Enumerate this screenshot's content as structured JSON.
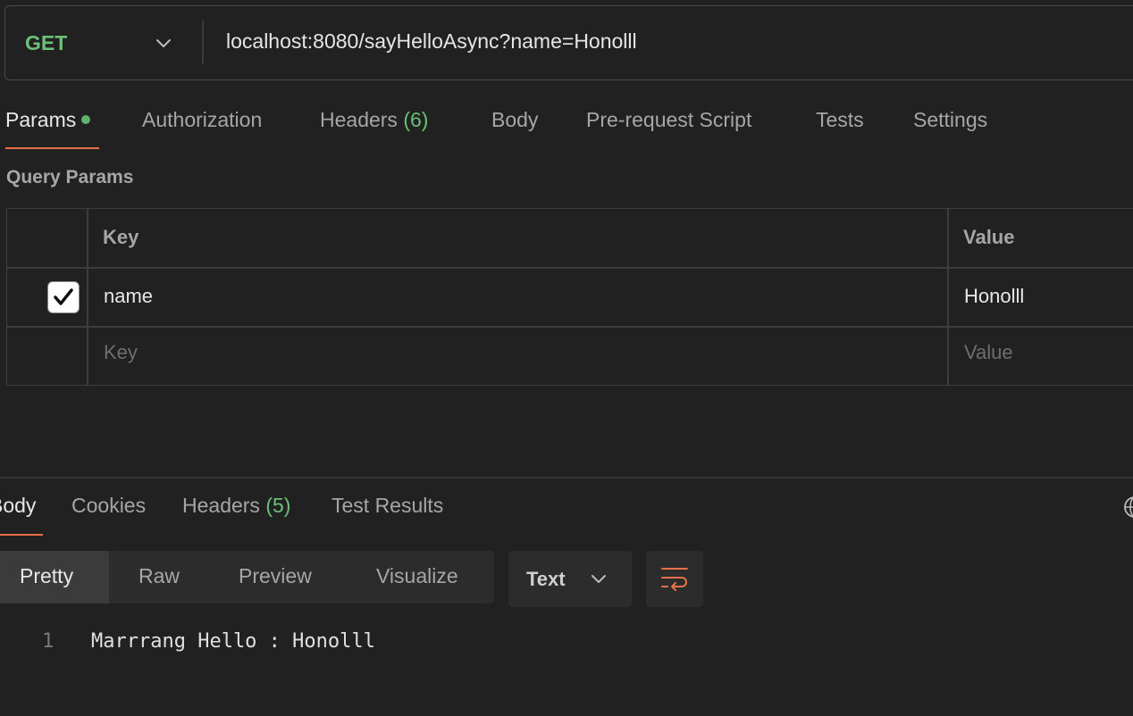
{
  "request": {
    "method": "GET",
    "url": "localhost:8080/sayHelloAsync?name=Honolll"
  },
  "request_tabs": {
    "params": "Params",
    "authorization": "Authorization",
    "headers": "Headers",
    "headers_count": "(6)",
    "body": "Body",
    "prerequest": "Pre-request Script",
    "tests": "Tests",
    "settings": "Settings"
  },
  "query_params": {
    "title": "Query Params",
    "columns": [
      "Key",
      "Value"
    ],
    "rows": [
      {
        "checked": true,
        "key": "name",
        "value": "Honolll"
      }
    ],
    "placeholders": {
      "key": "Key",
      "value": "Value"
    }
  },
  "response_tabs": {
    "body": "Body",
    "cookies": "Cookies",
    "headers": "Headers",
    "headers_count": "(5)",
    "test_results": "Test Results"
  },
  "view_modes": [
    "Pretty",
    "Raw",
    "Preview",
    "Visualize"
  ],
  "active_view_mode": "Pretty",
  "format": "Text",
  "response_body": {
    "lines": [
      {
        "number": "1",
        "text": "Marrrang Hello : Honolll"
      }
    ]
  },
  "colors": {
    "accent": "#e8704a",
    "method_get": "#6bbf78",
    "background": "#212121"
  },
  "icons": {
    "method_dropdown": "chevron-down-icon",
    "checkbox": "checkmark-icon",
    "globe": "globe-icon",
    "format_dropdown": "chevron-down-icon",
    "wrap": "wrap-lines-icon"
  }
}
